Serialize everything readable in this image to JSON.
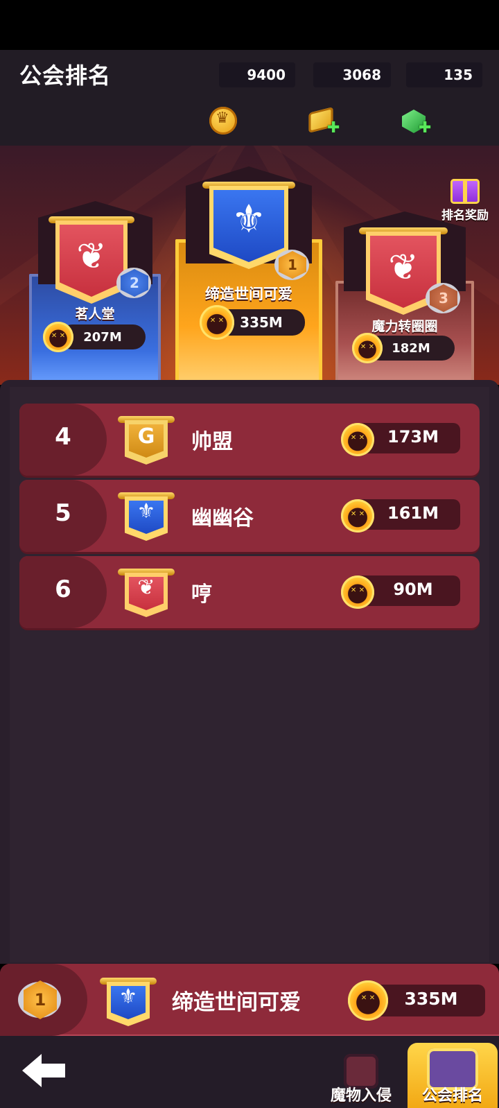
{
  "header": {
    "title": "公会排名",
    "resources": [
      {
        "icon": "crown-coin-icon",
        "value": "9400"
      },
      {
        "icon": "gold-bar-icon",
        "value": "3068"
      },
      {
        "icon": "green-gem-icon",
        "value": "135"
      }
    ]
  },
  "podium": {
    "first": {
      "rank": "1",
      "name": "缔造世间可爱",
      "score": "335M",
      "banner": "blue"
    },
    "second": {
      "rank": "2",
      "name": "茗人堂",
      "score": "207M",
      "banner": "red"
    },
    "third": {
      "rank": "3",
      "name": "魔力转圈圈",
      "score": "182M",
      "banner": "red"
    },
    "reward_label": "排名奖励"
  },
  "ranking": [
    {
      "rank": "4",
      "name": "帅盟",
      "score": "173M",
      "banner": "gold"
    },
    {
      "rank": "5",
      "name": "幽幽谷",
      "score": "161M",
      "banner": "blue"
    },
    {
      "rank": "6",
      "name": "哼",
      "score": "90M",
      "banner": "red"
    }
  ],
  "my_guild": {
    "rank": "1",
    "name": "缔造世间可爱",
    "score": "335M"
  },
  "nav": {
    "tab1": "魔物入侵",
    "tab2": "公会排名"
  },
  "colors": {
    "row": "#8e2a3a",
    "accent": "#ffb21f"
  }
}
